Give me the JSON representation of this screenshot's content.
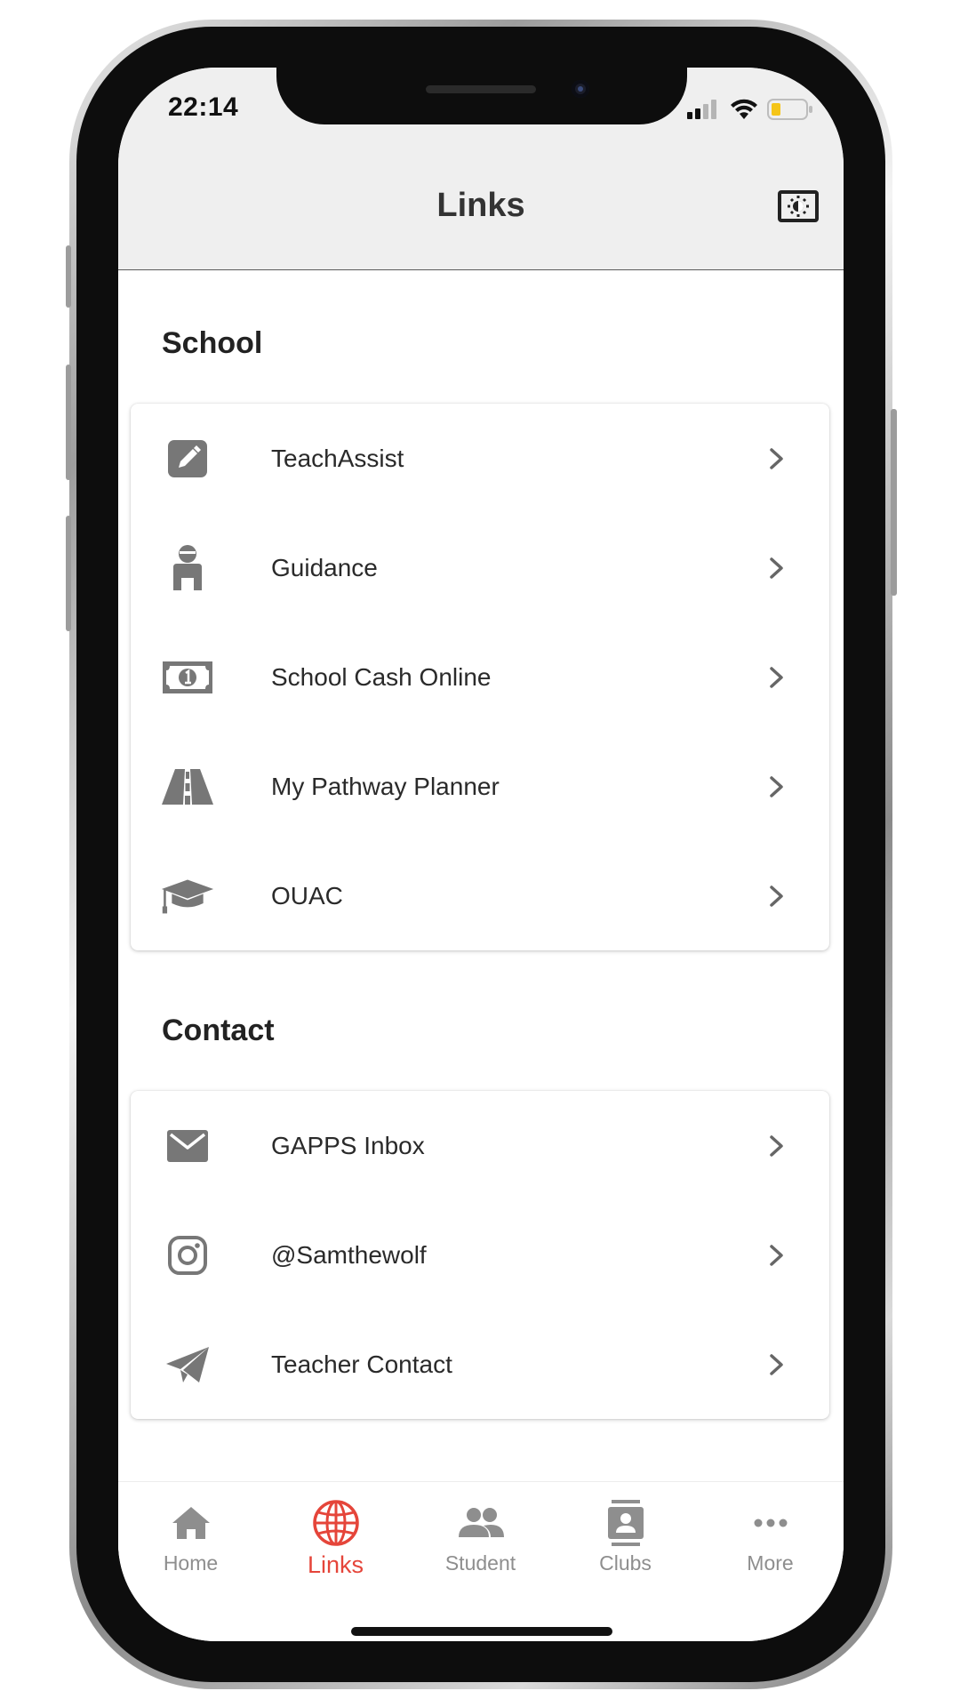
{
  "status_bar": {
    "time": "22:14"
  },
  "header": {
    "title": "Links"
  },
  "sections": [
    {
      "title": "School",
      "items": [
        {
          "label": "TeachAssist",
          "icon": "edit-icon"
        },
        {
          "label": "Guidance",
          "icon": "person-icon"
        },
        {
          "label": "School Cash Online",
          "icon": "money-bill-icon"
        },
        {
          "label": "My Pathway Planner",
          "icon": "road-icon"
        },
        {
          "label": "OUAC",
          "icon": "graduation-cap-icon"
        }
      ]
    },
    {
      "title": "Contact",
      "items": [
        {
          "label": "GAPPS Inbox",
          "icon": "envelope-icon"
        },
        {
          "label": "@Samthewolf",
          "icon": "instagram-icon"
        },
        {
          "label": "Teacher Contact",
          "icon": "paper-plane-icon"
        }
      ]
    }
  ],
  "tabs": [
    {
      "label": "Home",
      "icon": "home-icon",
      "active": false
    },
    {
      "label": "Links",
      "icon": "globe-icon",
      "active": true
    },
    {
      "label": "Student",
      "icon": "people-icon",
      "active": false
    },
    {
      "label": "Clubs",
      "icon": "contact-card-icon",
      "active": false
    },
    {
      "label": "More",
      "icon": "more-dots-icon",
      "active": false
    }
  ],
  "colors": {
    "accent": "#e5453a",
    "inactive": "#8e8e8e",
    "icon_gray": "#777777",
    "header_bg": "#efefef",
    "battery_fill": "#f5c518"
  }
}
